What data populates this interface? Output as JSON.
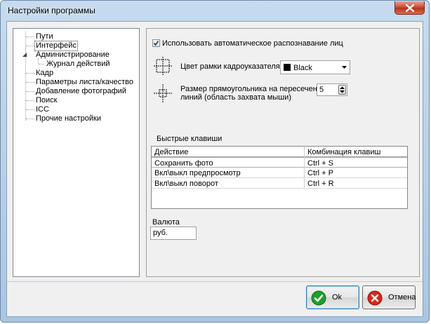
{
  "window": {
    "title": "Настройки программы"
  },
  "tree": {
    "items": [
      {
        "label": "Пути"
      },
      {
        "label": "Интерфейс"
      },
      {
        "label": "Администрирование"
      },
      {
        "label": "Журнал действий"
      },
      {
        "label": "Кадр"
      },
      {
        "label": "Параметры листа/качество"
      },
      {
        "label": "Добавление фотографий"
      },
      {
        "label": "Поиск"
      },
      {
        "label": "ICC"
      },
      {
        "label": "Прочие настройки"
      }
    ],
    "selected": "Интерфейс"
  },
  "settings": {
    "face_detection": {
      "label": "Использовать автоматическое распознавание лиц",
      "checked": true
    },
    "frame_color": {
      "label": "Цвет рамки кадроуказателя",
      "value": "Black",
      "swatch": "#000000"
    },
    "rect_size": {
      "label_line1": "Размер прямоугольника на пересечениях",
      "label_line2": "линий (область захвата мыши)",
      "value": "5"
    }
  },
  "hotkeys": {
    "group_label": "Быстрые клавиши",
    "columns": [
      "Действие",
      "Комбинация клавиш"
    ],
    "rows": [
      {
        "action": "Сохранить фото",
        "keys": "Ctrl + S"
      },
      {
        "action": "Вкл\\выкл предпросмотр",
        "keys": "Ctrl + P"
      },
      {
        "action": "Вкл\\выкл поворот",
        "keys": "Ctrl + R"
      }
    ]
  },
  "currency": {
    "label": "Валюта",
    "value": "руб."
  },
  "buttons": {
    "ok": {
      "label": "Ok",
      "icon": "check-icon",
      "color": "#1e9e2a"
    },
    "cancel": {
      "label": "Отмена",
      "icon": "cancel-icon",
      "color": "#d7261c"
    }
  }
}
